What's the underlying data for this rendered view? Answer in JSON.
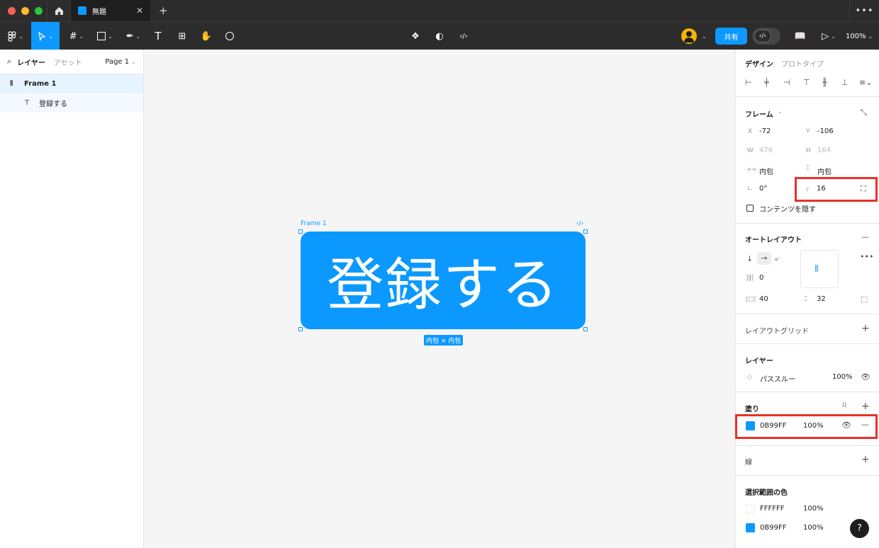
{
  "tabs": {
    "doc_title": "無題",
    "close": "✕",
    "add": "+",
    "more": "•••"
  },
  "toolbar": {
    "share": "共有",
    "zoom": "100%"
  },
  "left": {
    "layers_tab": "レイヤー",
    "assets_tab": "アセット",
    "page": "Page 1",
    "layers": [
      {
        "name": "Frame 1"
      },
      {
        "name": "登録する"
      }
    ]
  },
  "canvas": {
    "frame_label": "Frame 1",
    "code_icon": "‹/›",
    "button_text": "登録する",
    "size_badge": "内包 × 内包"
  },
  "design": {
    "tab_design": "デザイン",
    "tab_prototype": "プロトタイプ",
    "frame": {
      "title": "フレーム",
      "x_label": "X",
      "x": "-72",
      "y_label": "Y",
      "y": "-106",
      "w_label": "W",
      "w": "476",
      "h_label": "H",
      "h": "164",
      "hresize": "内包",
      "vresize": "内包",
      "rotation": "0°",
      "radius": "16",
      "clip": "コンテンツを隠す"
    },
    "autolayout": {
      "title": "オートレイアウト",
      "gap": "0",
      "padding_h": "40",
      "padding_v": "32"
    },
    "layout_grid": {
      "title": "レイアウトグリッド"
    },
    "layer": {
      "title": "レイヤー",
      "blend": "パススルー",
      "opacity": "100%"
    },
    "fill": {
      "title": "塗り",
      "hex": "0B99FF",
      "opacity": "100%",
      "color": "#0B99FF"
    },
    "stroke": {
      "title": "線"
    },
    "selection_colors": {
      "title": "選択範囲の色",
      "items": [
        {
          "hex": "FFFFFF",
          "opacity": "100%",
          "color": "#FFFFFF"
        },
        {
          "hex": "0B99FF",
          "opacity": "100%",
          "color": "#0B99FF"
        }
      ]
    }
  },
  "help": "?"
}
